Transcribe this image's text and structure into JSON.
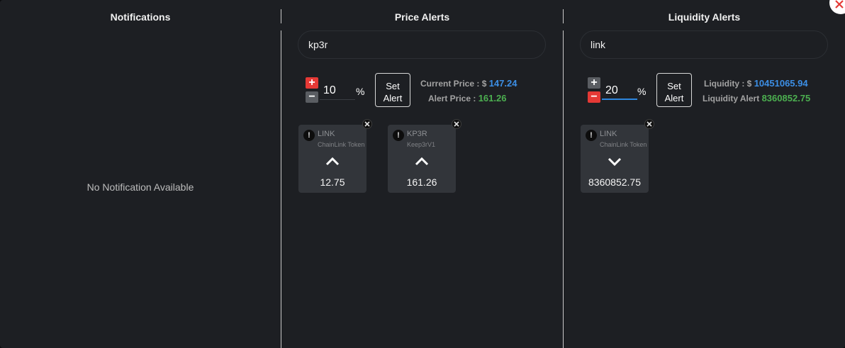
{
  "columns": {
    "notifications": {
      "title": "Notifications",
      "empty_text": "No Notification Available"
    },
    "price": {
      "title": "Price Alerts",
      "search_value": "kp3r",
      "percent": "10",
      "percent_sign": "%",
      "set_button": [
        "Set",
        "Alert"
      ],
      "current_label": "Current Price : $",
      "current_value": "147.24",
      "alert_label": "Alert Price :",
      "alert_value": "161.26",
      "cards": [
        {
          "symbol": "LINK",
          "name": "ChainLink Token",
          "value": "12.75",
          "direction": "up"
        },
        {
          "symbol": "KP3R",
          "name": "Keep3rV1",
          "value": "161.26",
          "direction": "up"
        }
      ]
    },
    "liquidity": {
      "title": "Liquidity Alerts",
      "search_value": "link",
      "percent": "20",
      "percent_sign": "%",
      "set_button": [
        "Set",
        "Alert"
      ],
      "current_label": "Liquidity : $",
      "current_value": "10451065.94",
      "alert_label": "Liquidity Alert",
      "alert_value": "8360852.75",
      "cards": [
        {
          "symbol": "LINK",
          "name": "ChainLink Token",
          "value": "8360852.75",
          "direction": "down"
        }
      ]
    }
  },
  "colors": {
    "accent_blue": "#3c8fe6",
    "accent_green": "#4caf50",
    "danger": "#e53935",
    "panel": "#1d1f23",
    "card": "#32353a"
  },
  "icons": {
    "close": "close-icon",
    "warning": "exclamation-icon",
    "up": "chevron-up-icon",
    "down": "chevron-down-icon"
  }
}
